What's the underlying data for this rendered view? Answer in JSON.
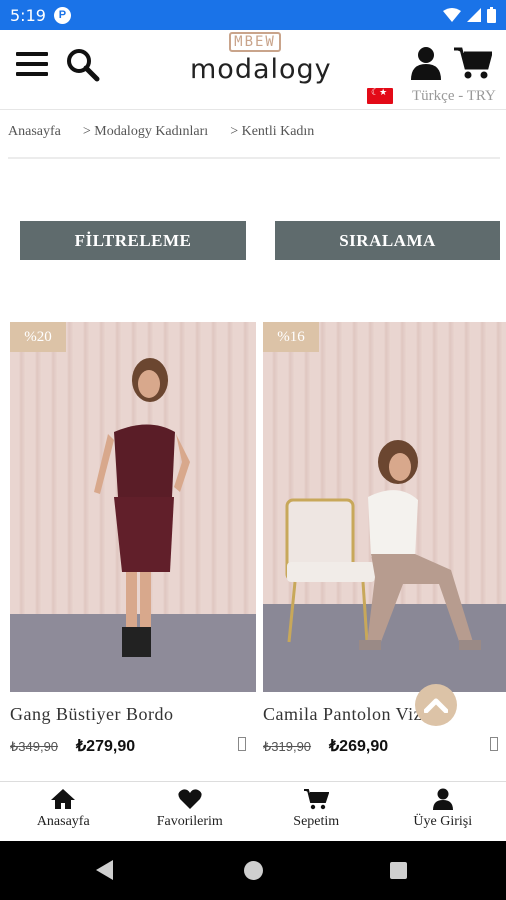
{
  "status": {
    "time": "5:19",
    "app_badge": "P"
  },
  "header": {
    "logo_monogram": "MBEW",
    "logo_text": "modalogy",
    "language": "Türkçe - TRY",
    "flag": "turkey-flag"
  },
  "breadcrumb": [
    "Anasayfa",
    "> Modalogy Kadınları",
    "> Kentli Kadın"
  ],
  "actions": {
    "filter": "FİLTRELEME",
    "sort": "SIRALAMA"
  },
  "products": [
    {
      "badge": "%20",
      "name": "Gang Büstiyer Bordo",
      "old_price": "₺349,90",
      "price": "₺279,90"
    },
    {
      "badge": "%16",
      "name": "Camila Pantolon Vizon",
      "old_price": "₺319,90",
      "price": "₺269,90"
    }
  ],
  "tabs": [
    {
      "label": "Anasayfa",
      "icon": "home-icon"
    },
    {
      "label": "Favorilerim",
      "icon": "heart-icon"
    },
    {
      "label": "Sepetim",
      "icon": "cart-icon"
    },
    {
      "label": "Üye Girişi",
      "icon": "user-icon"
    }
  ],
  "colors": {
    "status_bar": "#1a73e8",
    "button": "#5f6b6d",
    "accent": "#dcc3a7"
  }
}
